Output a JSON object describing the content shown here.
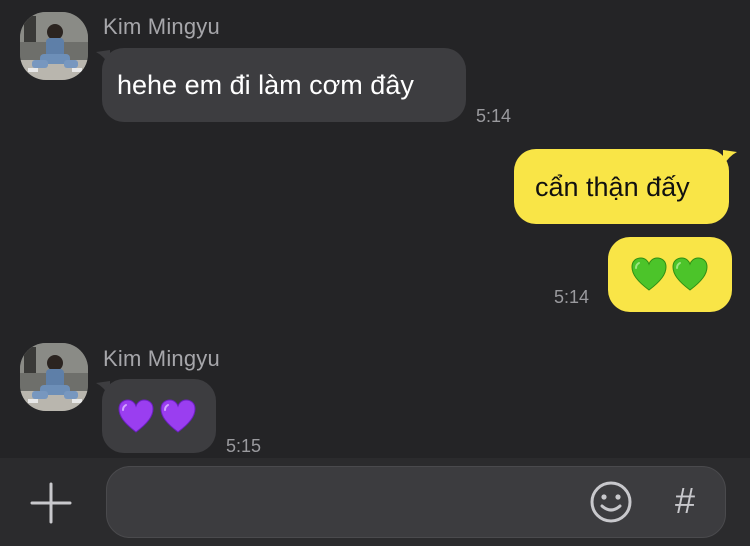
{
  "colors": {
    "background": "#242426",
    "incoming_bubble": "#3d3d40",
    "outgoing_bubble": "#f9e547",
    "composer": "#2b2b2d"
  },
  "messages": [
    {
      "direction": "incoming",
      "sender": "Kim Mingyu",
      "avatar": "avatar-photo",
      "text": "hehe em đi làm cơm đây",
      "time": "5:14"
    },
    {
      "direction": "outgoing",
      "text": "cẩn thận đấy"
    },
    {
      "direction": "outgoing",
      "text": "💚💚",
      "emoji": "green-heart",
      "time": "5:14"
    },
    {
      "direction": "incoming",
      "sender": "Kim Mingyu",
      "avatar": "avatar-photo",
      "text": "💜💜",
      "emoji": "purple-heart",
      "time": "5:15"
    }
  ],
  "composer": {
    "plus_icon": "plus-icon",
    "input_value": "",
    "emoji_icon": "smiley-icon",
    "hash_label": "#"
  }
}
